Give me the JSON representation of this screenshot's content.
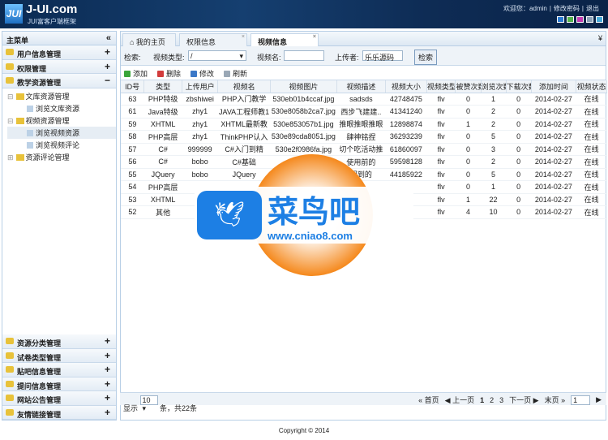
{
  "header": {
    "logo": "JUI",
    "brand": "J-UI.com",
    "subtitle": "JUI富客户端框架",
    "welcome": "欢迎您：admin",
    "change_pwd": "修改密码",
    "logout": "退出",
    "themes": [
      "#2a7ad1",
      "#53b34a",
      "#c43bb1",
      "#8aa0b6",
      "#47a9d8"
    ]
  },
  "sidebar": {
    "title": "主菜单",
    "collapse": "«",
    "top": [
      {
        "label": "用户信息管理",
        "sign": "+"
      },
      {
        "label": "权限管理",
        "sign": "+"
      },
      {
        "label": "教学资源管理",
        "sign": "−"
      }
    ],
    "tree": [
      {
        "label": "文库资源管理",
        "toggle": "⊟",
        "level": 1
      },
      {
        "label": "浏览文库资源",
        "level": 2
      },
      {
        "label": "视频资源管理",
        "toggle": "⊟",
        "level": 1
      },
      {
        "label": "浏览视频资源",
        "level": 2,
        "selected": true
      },
      {
        "label": "浏览视频评论",
        "level": 2
      },
      {
        "label": "资源评论管理",
        "toggle": "⊞",
        "level": 1
      }
    ],
    "bottom": [
      {
        "label": "资源分类管理",
        "sign": "+"
      },
      {
        "label": "试卷类型管理",
        "sign": "+"
      },
      {
        "label": "贴吧信息管理",
        "sign": "+"
      },
      {
        "label": "提问信息管理",
        "sign": "+"
      },
      {
        "label": "网站公告管理",
        "sign": "+"
      },
      {
        "label": "友情链接管理",
        "sign": "+"
      }
    ]
  },
  "tabs": [
    {
      "label": "⌂ 我的主页"
    },
    {
      "label": "权限信息",
      "close": "×"
    },
    {
      "label": "视频信息",
      "close": "×",
      "active": true
    }
  ],
  "tabs_more": "¥",
  "search": {
    "label": "检索:",
    "type_label": "视频类型:",
    "type_value": "/",
    "name_label": "视频名:",
    "name_value": "",
    "uploader_label": "上传者:",
    "uploader_value": "乐乐源码",
    "button": "检索"
  },
  "toolbar": [
    {
      "label": "添加",
      "color": "#3aa53a"
    },
    {
      "label": "删除",
      "color": "#d23c3c"
    },
    {
      "label": "修改",
      "color": "#3a78c8"
    },
    {
      "label": "刷新",
      "color": "#9aa8b6"
    }
  ],
  "table": {
    "columns": [
      "ID号",
      "类型",
      "上传用户",
      "视频名",
      "视频图片",
      "视频描述",
      "视频大小",
      "视频类型",
      "被赞次数",
      "浏览次数",
      "下载次数",
      "添加时间",
      "视频状态"
    ],
    "rows": [
      [
        "63",
        "PHP特级",
        "zbshiwei",
        "PHP入门教学",
        "530eb01b4ccaf.jpg",
        "sadsds",
        "42748475",
        "flv",
        "0",
        "1",
        "0",
        "2014-02-27",
        "在线"
      ],
      [
        "61",
        "Java特级",
        "zhy1",
        "JAVA工程师教1",
        "530e8058b2ca7.jpg",
        "西步飞建建..",
        "41341240",
        "flv",
        "0",
        "2",
        "0",
        "2014-02-27",
        "在线"
      ],
      [
        "59",
        "XHTML",
        "zhy1",
        "XHTML最新教",
        "530e853057b1.jpg",
        "推眼推眼推眼",
        "12898874",
        "flv",
        "1",
        "2",
        "0",
        "2014-02-27",
        "在线"
      ],
      [
        "58",
        "PHP高层",
        "zhy1",
        "ThinkPHP认入",
        "530e89cda8051.jpg",
        "肆神铭捏",
        "36293239",
        "flv",
        "0",
        "5",
        "0",
        "2014-02-27",
        "在线"
      ],
      [
        "57",
        "C#",
        "999999",
        "C#入门到精",
        "530e2f0986fa.jpg",
        "切个吃活动推",
        "61860097",
        "flv",
        "0",
        "3",
        "0",
        "2014-02-27",
        "在线"
      ],
      [
        "56",
        "C#",
        "bobo",
        "C#基础",
        "",
        "使用前的",
        "59598128",
        "flv",
        "0",
        "2",
        "0",
        "2014-02-27",
        "在线"
      ],
      [
        "55",
        "JQuery",
        "bobo",
        "JQuery",
        "",
        "门到的",
        "44185922",
        "flv",
        "0",
        "5",
        "0",
        "2014-02-27",
        "在线"
      ],
      [
        "54",
        "PHP高层",
        "",
        "",
        "",
        "",
        "",
        "flv",
        "0",
        "1",
        "0",
        "2014-02-27",
        "在线"
      ],
      [
        "53",
        "XHTML",
        "w",
        "",
        "",
        "",
        "",
        "flv",
        "1",
        "22",
        "0",
        "2014-02-27",
        "在线"
      ],
      [
        "52",
        "其他",
        "w",
        "",
        "",
        "",
        "",
        "flv",
        "4",
        "10",
        "0",
        "2014-02-27",
        "在线"
      ]
    ]
  },
  "pager": {
    "show": "显示",
    "size": "10",
    "total": "条，共22条",
    "first": "« 首页",
    "prev": "◀ 上一页",
    "pages": [
      "1",
      "2",
      "3"
    ],
    "next": "下一页 ▶",
    "last": "末页 »",
    "goto": "1",
    "go": "▶"
  },
  "footer": "Copyright © 2014",
  "watermark": {
    "cn": "菜鸟吧",
    "url": "www.cniao8.com"
  }
}
